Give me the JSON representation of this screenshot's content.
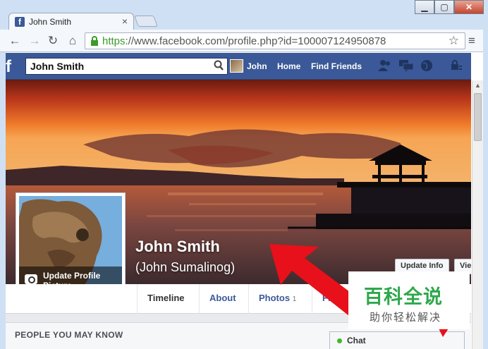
{
  "browser": {
    "tab_title": "John Smith",
    "tab_close": "×",
    "window_buttons": [
      "▁",
      "▢",
      "✕"
    ],
    "url_scheme": "https",
    "url_rest": "://www.facebook.com/profile.php?id=100007124950878"
  },
  "fb": {
    "logo": "f",
    "search_value": "John Smith",
    "nav": {
      "user": "John",
      "home": "Home",
      "find_friends": "Find Friends"
    }
  },
  "profile": {
    "name": "John Smith",
    "alt_name": "(John Sumalinog)",
    "update_picture": "Update Profile Picture",
    "update_info": "Update Info",
    "view_activity": "Vie"
  },
  "tabs": [
    {
      "label": "Timeline"
    },
    {
      "label": "About"
    },
    {
      "label": "Photos",
      "count": "1"
    },
    {
      "label": "Friend"
    }
  ],
  "pymk_title": "PEOPLE YOU MAY KNOW",
  "chat_label": "Chat",
  "watermark": {
    "main": "百科全说",
    "sub": "助你轻松解决"
  },
  "colors": {
    "fb_blue": "#3b5998",
    "annotation_red": "#e8101a",
    "watermark_green": "#2ea84b"
  }
}
